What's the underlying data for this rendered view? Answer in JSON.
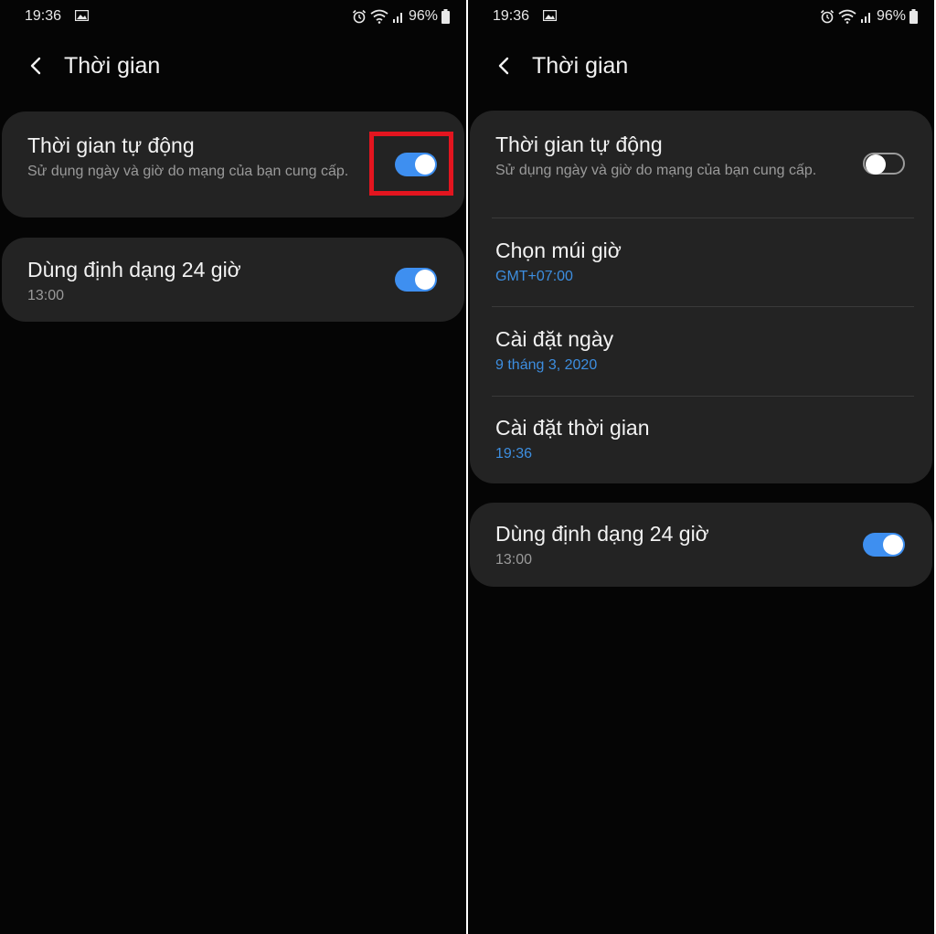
{
  "colors": {
    "background": "#050505",
    "card": "#232323",
    "accent_blue": "#3e8ff0",
    "highlight_red": "#e3151f",
    "subtitle_gray": "#9a9a9a",
    "value_blue": "#3d8ee0"
  },
  "left_screen": {
    "status": {
      "time": "19:36",
      "battery": "96%"
    },
    "header": {
      "title": "Thời gian",
      "back_icon": "chevron-left-icon"
    },
    "auto_time": {
      "title": "Thời gian tự động",
      "subtitle": "Sử dụng ngày và giờ do mạng của bạn cung cấp.",
      "toggle_on": true
    },
    "format_24h": {
      "title": "Dùng định dạng 24 giờ",
      "subtitle": "13:00",
      "toggle_on": true
    }
  },
  "right_screen": {
    "status": {
      "time": "19:36",
      "battery": "96%"
    },
    "header": {
      "title": "Thời gian",
      "back_icon": "chevron-left-icon"
    },
    "auto_time": {
      "title": "Thời gian tự động",
      "subtitle": "Sử dụng ngày và giờ do mạng của bạn cung cấp.",
      "toggle_on": false
    },
    "timezone": {
      "title": "Chọn múi giờ",
      "value": "GMT+07:00"
    },
    "set_date": {
      "title": "Cài đặt ngày",
      "value": "9 tháng 3, 2020"
    },
    "set_time": {
      "title": "Cài đặt thời gian",
      "value": "19:36"
    },
    "format_24h": {
      "title": "Dùng định dạng 24 giờ",
      "subtitle": "13:00",
      "toggle_on": true
    }
  }
}
